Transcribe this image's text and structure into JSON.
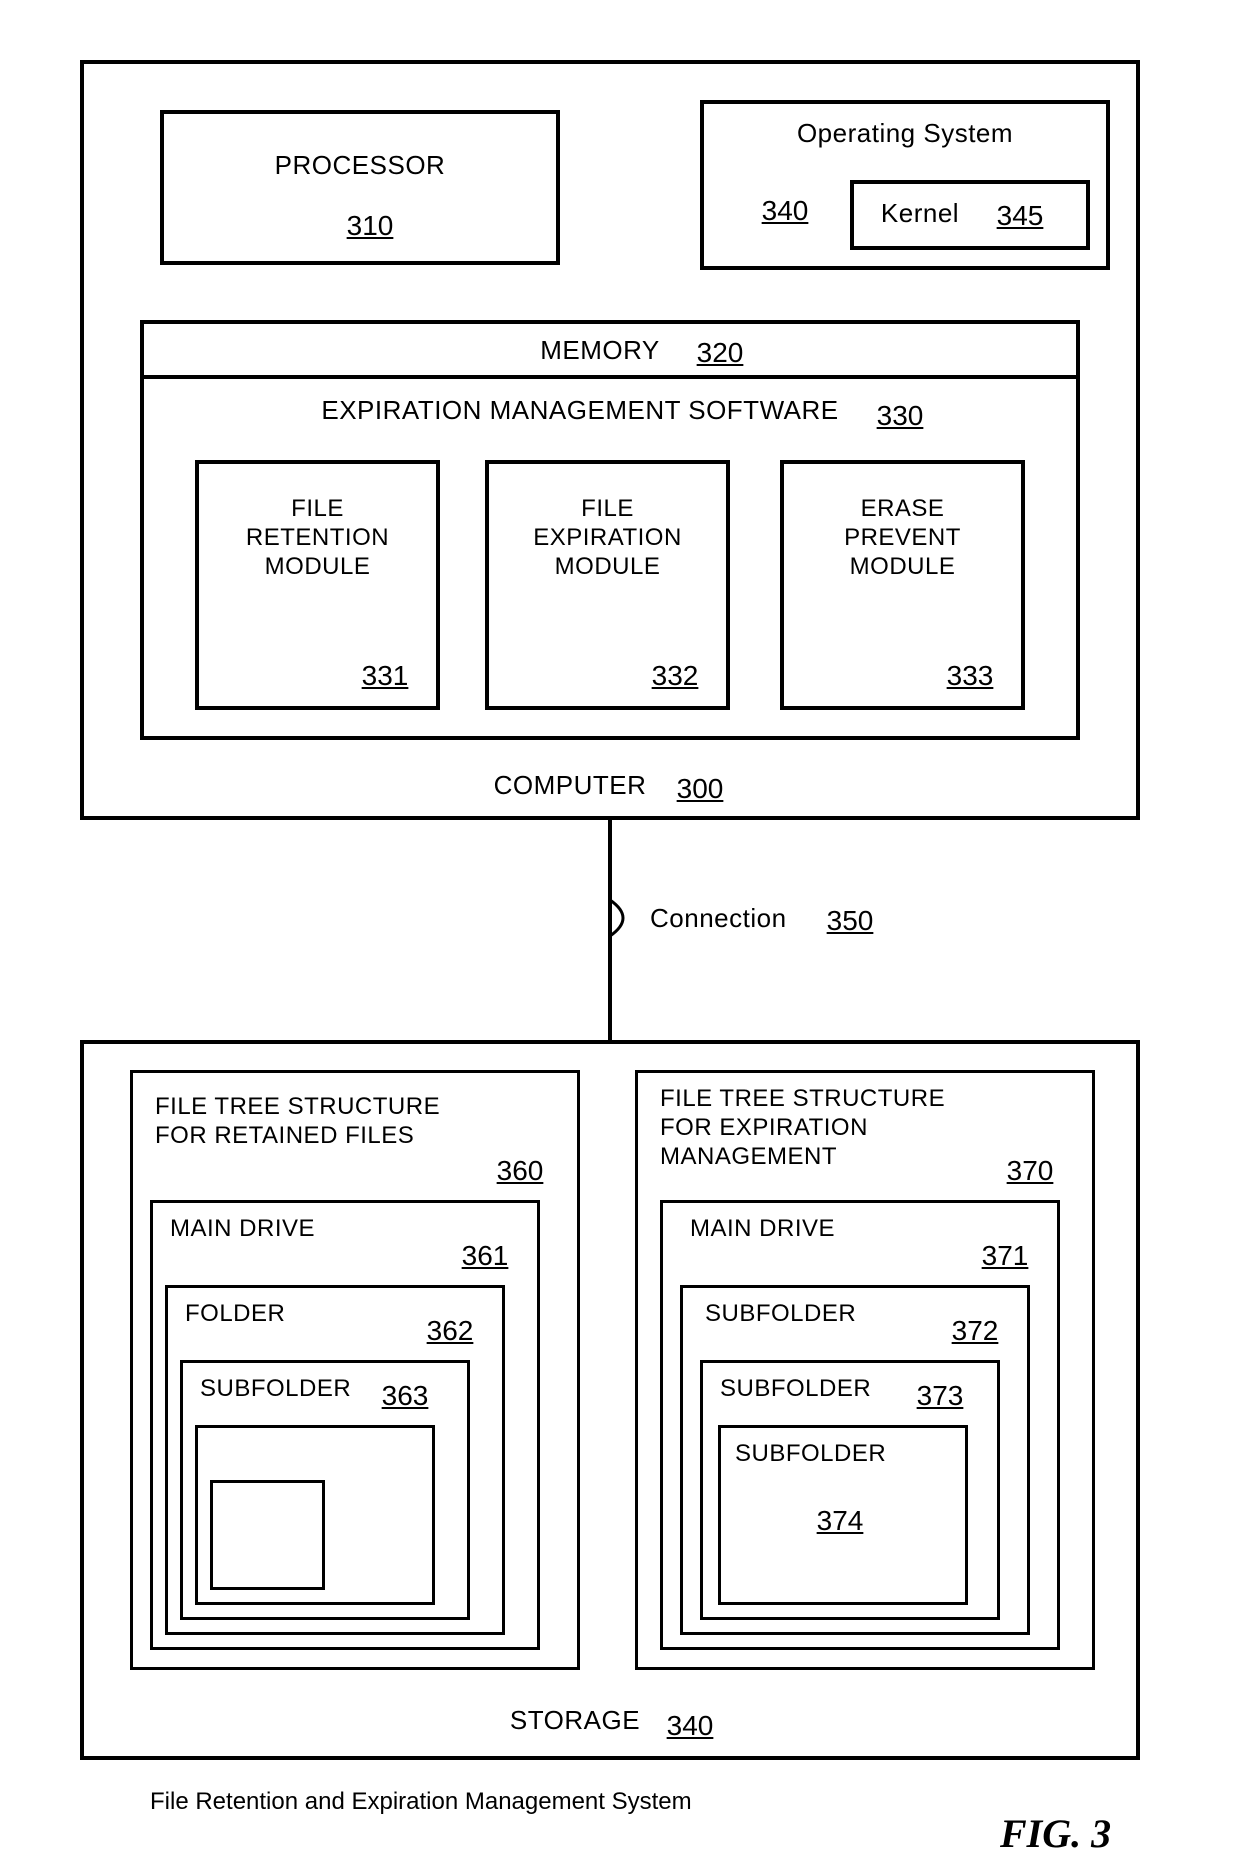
{
  "computer": {
    "label": "COMPUTER",
    "ref": "300",
    "processor": {
      "label": "PROCESSOR",
      "ref": "310"
    },
    "os": {
      "label": "Operating System",
      "ref": "340",
      "kernel": {
        "label": "Kernel",
        "ref": "345"
      }
    },
    "memory": {
      "label": "MEMORY",
      "ref": "320"
    },
    "ems": {
      "label": "EXPIRATION MANAGEMENT SOFTWARE",
      "ref": "330",
      "modules": [
        {
          "label": "FILE\nRETENTION\nMODULE",
          "ref": "331"
        },
        {
          "label": "FILE\nEXPIRATION\nMODULE",
          "ref": "332"
        },
        {
          "label": "ERASE\nPREVENT\nMODULE",
          "ref": "333"
        }
      ]
    }
  },
  "connection": {
    "label": "Connection",
    "ref": "350"
  },
  "storage": {
    "label": "STORAGE",
    "ref": "340",
    "retained_tree": {
      "title": "FILE TREE STRUCTURE\nFOR RETAINED FILES",
      "ref": "360",
      "levels": [
        {
          "label": "MAIN DRIVE",
          "ref": "361"
        },
        {
          "label": "FOLDER",
          "ref": "362"
        },
        {
          "label": "SUBFOLDER",
          "ref": "363"
        },
        {
          "label": "",
          "ref": ""
        },
        {
          "label": "",
          "ref": ""
        }
      ]
    },
    "expiration_tree": {
      "title": "FILE TREE STRUCTURE\nFOR EXPIRATION\nMANAGEMENT",
      "ref": "370",
      "levels": [
        {
          "label": "MAIN DRIVE",
          "ref": "371"
        },
        {
          "label": "SUBFOLDER",
          "ref": "372"
        },
        {
          "label": "SUBFOLDER",
          "ref": "373"
        },
        {
          "label": "SUBFOLDER",
          "ref": "374"
        }
      ]
    }
  },
  "caption": "File Retention and Expiration Management System",
  "figure": "FIG. 3"
}
